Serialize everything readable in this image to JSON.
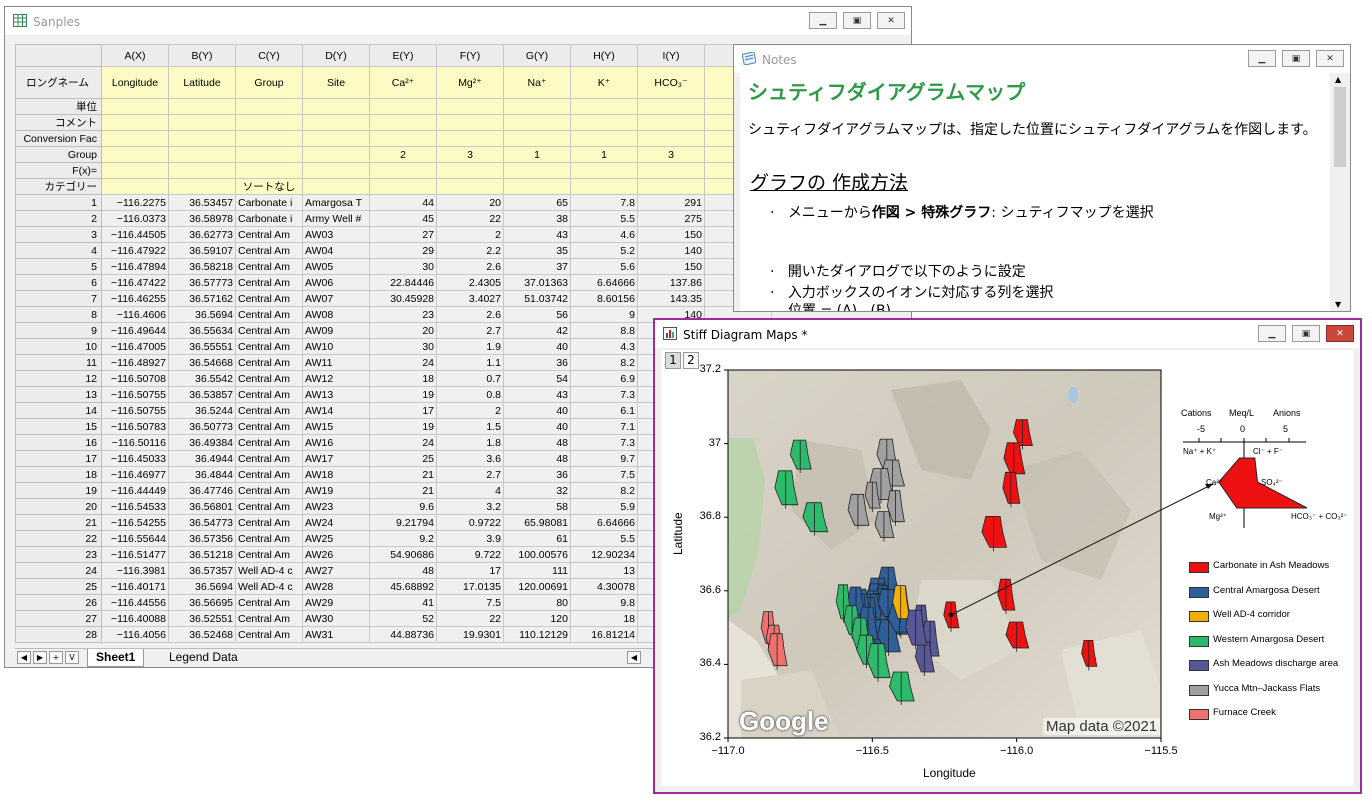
{
  "spreadsheet": {
    "title": "Sanples",
    "columns": [
      "A(X)",
      "B(Y)",
      "C(Y)",
      "D(Y)",
      "E(Y)",
      "F(Y)",
      "G(Y)",
      "H(Y)",
      "I(Y)",
      "J("
    ],
    "meta_labels": {
      "longname": "ロングネーム",
      "units": "単位",
      "comment": "コメント",
      "conv": "Conversion Fac",
      "group": "Group",
      "fx": "F(x)=",
      "category": "カテゴリー"
    },
    "longnames": [
      "Longitude",
      "Latitude",
      "Group",
      "Site",
      "Ca²⁺",
      "Mg²⁺",
      "Na⁺",
      "K⁺",
      "HCO₃⁻",
      "C"
    ],
    "groups": [
      "",
      "",
      "",
      "",
      "2",
      "3",
      "1",
      "1",
      "3",
      ""
    ],
    "categories": [
      "",
      "",
      "ソートなし",
      "",
      "",
      "",
      "",
      "",
      "",
      ""
    ],
    "rows": [
      [
        "1",
        "−116.2275",
        "36.53457",
        "Carbonate i",
        "Amargosa T",
        "44",
        "20",
        "65",
        "7.8",
        "291"
      ],
      [
        "2",
        "−116.0373",
        "36.58978",
        "Carbonate i",
        "Army Well #",
        "45",
        "22",
        "38",
        "5.5",
        "275"
      ],
      [
        "3",
        "−116.44505",
        "36.62773",
        "Central Am",
        "AW03",
        "27",
        "2",
        "43",
        "4.6",
        "150"
      ],
      [
        "4",
        "−116.47922",
        "36.59107",
        "Central Am",
        "AW04",
        "29",
        "2.2",
        "35",
        "5.2",
        "140"
      ],
      [
        "5",
        "−116.47894",
        "36.58218",
        "Central Am",
        "AW05",
        "30",
        "2.6",
        "37",
        "5.6",
        "150"
      ],
      [
        "6",
        "−116.47422",
        "36.57773",
        "Central Am",
        "AW06",
        "22.84446",
        "2.4305",
        "37.01363",
        "6.64666",
        "137.86"
      ],
      [
        "7",
        "−116.46255",
        "36.57162",
        "Central Am",
        "AW07",
        "30.45928",
        "3.4027",
        "51.03742",
        "8.60156",
        "143.35"
      ],
      [
        "8",
        "−116.4606",
        "36.5694",
        "Central Am",
        "AW08",
        "23",
        "2.6",
        "56",
        "9",
        "140"
      ],
      [
        "9",
        "−116.49644",
        "36.55634",
        "Central Am",
        "AW09",
        "20",
        "2.7",
        "42",
        "8.8",
        "150"
      ],
      [
        "10",
        "−116.47005",
        "36.55551",
        "Central Am",
        "AW10",
        "30",
        "1.9",
        "40",
        "4.3",
        "150"
      ],
      [
        "11",
        "−116.48927",
        "36.54668",
        "Central Am",
        "AW11",
        "24",
        "1.1",
        "36",
        "8.2",
        "140"
      ],
      [
        "12",
        "−116.50708",
        "36.5542",
        "Central Am",
        "AW12",
        "18",
        "0.7",
        "54",
        "6.9",
        "150"
      ],
      [
        "13",
        "−116.50755",
        "36.53857",
        "Central Am",
        "AW13",
        "19",
        "0.8",
        "43",
        "7.3",
        "140"
      ],
      [
        "14",
        "−116.50755",
        "36.5244",
        "Central Am",
        "AW14",
        "17",
        "2",
        "40",
        "6.1",
        "140"
      ],
      [
        "15",
        "−116.50783",
        "36.50773",
        "Central Am",
        "AW15",
        "19",
        "1.5",
        "40",
        "7.1",
        "150"
      ],
      [
        "16",
        "−116.50116",
        "36.49384",
        "Central Am",
        "AW16",
        "24",
        "1.8",
        "48",
        "7.3",
        "140"
      ],
      [
        "17",
        "−116.45033",
        "36.4944",
        "Central Am",
        "AW17",
        "25",
        "3.6",
        "48",
        "9.7",
        "150"
      ],
      [
        "18",
        "−116.46977",
        "36.4844",
        "Central Am",
        "AW18",
        "21",
        "2.7",
        "36",
        "7.5",
        "140"
      ],
      [
        "19",
        "−116.44449",
        "36.47746",
        "Central Am",
        "AW19",
        "21",
        "4",
        "32",
        "8.2",
        "140"
      ],
      [
        "20",
        "−116.54533",
        "36.56801",
        "Central Am",
        "AW23",
        "9.6",
        "3.2",
        "58",
        "5.9",
        "140"
      ],
      [
        "21",
        "−116.54255",
        "36.54773",
        "Central Am",
        "AW24",
        "9.21794",
        "0.9722",
        "65.98081",
        "6.64666",
        "140"
      ],
      [
        "22",
        "−116.55644",
        "36.57356",
        "Central Am",
        "AW25",
        "9.2",
        "3.9",
        "61",
        "5.5",
        "140"
      ],
      [
        "23",
        "−116.51477",
        "36.51218",
        "Central Am",
        "AW26",
        "54.90686",
        "9.722",
        "100.00576",
        "12.90234",
        "140"
      ],
      [
        "24",
        "−116.3981",
        "36.57357",
        "Well AD-4 c",
        "AW27",
        "48",
        "17",
        "111",
        "13",
        "140"
      ],
      [
        "25",
        "−116.40171",
        "36.5694",
        "Well AD-4 c",
        "AW28",
        "45.68892",
        "17.0135",
        "120.00691",
        "4.30078",
        "140"
      ],
      [
        "26",
        "−116.44556",
        "36.56695",
        "Central Am",
        "AW29",
        "41",
        "7.5",
        "80",
        "9.8",
        "140"
      ],
      [
        "27",
        "−116.40088",
        "36.52551",
        "Central Am",
        "AW30",
        "52",
        "22",
        "120",
        "18",
        "140"
      ],
      [
        "28",
        "−116.4056",
        "36.52468",
        "Central Am",
        "AW31",
        "44.88736",
        "19.9301",
        "110.12129",
        "16.81214",
        "140"
      ]
    ],
    "tabs": [
      "Sheet1",
      "Legend Data"
    ]
  },
  "notes": {
    "title": "Notes",
    "heading": "シュティフダイアグラムマップ",
    "intro": "シュティフダイアグラムマップは、指定した位置にシュティフダイアグラムを作図します。",
    "subheading": "グラフの 作成方法",
    "step1_pre": "メニューから",
    "step1_b1": "作図 > 特殊グラフ",
    "step1_mid": ": シュティフマップ",
    "step1_post": "を選択",
    "step2": "開いたダイアログで以下のように設定",
    "step3": "入力ボックスのイオンに対応する列を選択",
    "step4": "位置 = (A) , (B)"
  },
  "graph": {
    "title": "Stiff Diagram Maps *",
    "layer_tabs": [
      "1",
      "2"
    ],
    "watermark": "Google",
    "map_credit": "Map data ©2021",
    "xlabel": "Longitude",
    "ylabel": "Latitude",
    "xticks": [
      "−117.0",
      "−116.5",
      "−116.0",
      "−115.5"
    ],
    "yticks": [
      "36.2",
      "36.4",
      "36.6",
      "36.8",
      "37",
      "37.2"
    ],
    "inset": {
      "cations": "Cations",
      "meq": "Meq/L",
      "anions": "Anions",
      "ticks": [
        "-5",
        "0",
        "5"
      ],
      "left_ions": [
        "Na⁺ + K⁺",
        "Ca²⁺",
        "Mg²⁺"
      ],
      "right_ions": [
        "Cl⁻ + F⁻",
        "SO₄²⁻",
        "HCO₃⁻ + CO₃²⁻"
      ]
    },
    "legend": [
      {
        "label": "Carbonate in Ash Meadows",
        "color": "#ee1111"
      },
      {
        "label": "Central Amargosa Desert",
        "color": "#2e5f9a"
      },
      {
        "label": "Well AD-4 corridor",
        "color": "#f2b100"
      },
      {
        "label": "Western Amargosa Desert",
        "color": "#2dba6b"
      },
      {
        "label": "Ash Meadows discharge area",
        "color": "#585898"
      },
      {
        "label": "Yucca Mtn–Jackass Flats",
        "color": "#a0a0a0"
      },
      {
        "label": "Furnace Creek",
        "color": "#f07070"
      }
    ]
  },
  "chart_data": {
    "type": "scatter",
    "xlabel": "Longitude",
    "ylabel": "Latitude",
    "xlim": [
      -117.0,
      -115.5
    ],
    "ylim": [
      36.2,
      37.2
    ],
    "series": [
      {
        "name": "Carbonate in Ash Meadows",
        "x": [
          -116.2275,
          -116.0373,
          -115.98,
          -116.01,
          -116.0,
          -116.08,
          -115.75,
          -116.02
        ],
        "y": [
          36.53457,
          36.58978,
          37.03,
          36.96,
          36.48,
          36.76,
          36.43,
          36.88
        ]
      },
      {
        "name": "Central Amargosa Desert",
        "x": [
          -116.44505,
          -116.47922,
          -116.47894,
          -116.46255,
          -116.4606,
          -116.49644,
          -116.47005,
          -116.48927,
          -116.50708,
          -116.50755,
          -116.50116,
          -116.45033,
          -116.46977,
          -116.44449,
          -116.54533,
          -116.54255,
          -116.55644,
          -116.51477,
          -116.44556,
          -116.40088,
          -116.4056
        ],
        "y": [
          36.62773,
          36.59107,
          36.58218,
          36.57162,
          36.5694,
          36.55634,
          36.55551,
          36.54668,
          36.5542,
          36.53857,
          36.49384,
          36.4944,
          36.4844,
          36.47746,
          36.56801,
          36.54773,
          36.57356,
          36.51218,
          36.56695,
          36.52551,
          36.52468
        ]
      },
      {
        "name": "Well AD-4 corridor",
        "x": [
          -116.3981,
          -116.40171
        ],
        "y": [
          36.57357,
          36.5694
        ]
      },
      {
        "name": "Western Amargosa Desert",
        "x": [
          -116.75,
          -116.8,
          -116.7,
          -116.6,
          -116.57,
          -116.54,
          -116.52,
          -116.48,
          -116.4
        ],
        "y": [
          36.97,
          36.88,
          36.8,
          36.57,
          36.52,
          36.48,
          36.44,
          36.41,
          36.34
        ]
      },
      {
        "name": "Ash Meadows discharge area",
        "x": [
          -116.33,
          -116.3,
          -116.32,
          -116.35
        ],
        "y": [
          36.52,
          36.47,
          36.42,
          36.5
        ]
      },
      {
        "name": "Yucca Mtn–Jackass Flats",
        "x": [
          -116.45,
          -116.43,
          -116.47,
          -116.5,
          -116.42,
          -116.46,
          -116.55
        ],
        "y": [
          36.97,
          36.92,
          36.89,
          36.86,
          36.83,
          36.78,
          36.82
        ]
      },
      {
        "name": "Furnace Creek",
        "x": [
          -116.86,
          -116.84,
          -116.83
        ],
        "y": [
          36.5,
          36.47,
          36.44
        ]
      }
    ]
  }
}
